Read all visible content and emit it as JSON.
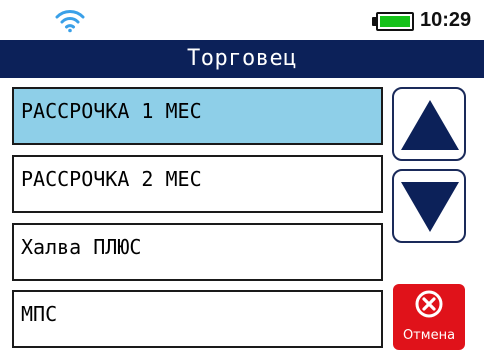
{
  "status": {
    "time": "10:29",
    "battery_level": 1.0,
    "wifi_icon": "wifi-icon"
  },
  "header": {
    "title": "Торговец"
  },
  "menu": {
    "items": [
      {
        "label": "РАССРОЧКА 1 МЕС",
        "selected": true
      },
      {
        "label": "РАССРОЧКА 2 МЕС",
        "selected": false
      },
      {
        "label": "Халва ПЛЮС",
        "selected": false
      },
      {
        "label": "МПС",
        "selected": false
      }
    ]
  },
  "controls": {
    "up_icon": "arrow-up-icon",
    "down_icon": "arrow-down-icon",
    "cancel_label": "Отмена",
    "cancel_icon": "close-circle-icon"
  },
  "colors": {
    "header_bg": "#0c2159",
    "selected_bg": "#8ecfe8",
    "cancel_bg": "#e0121a",
    "battery_fill": "#16c21a",
    "wifi": "#3aa0e8",
    "arrow": "#0c2159"
  }
}
